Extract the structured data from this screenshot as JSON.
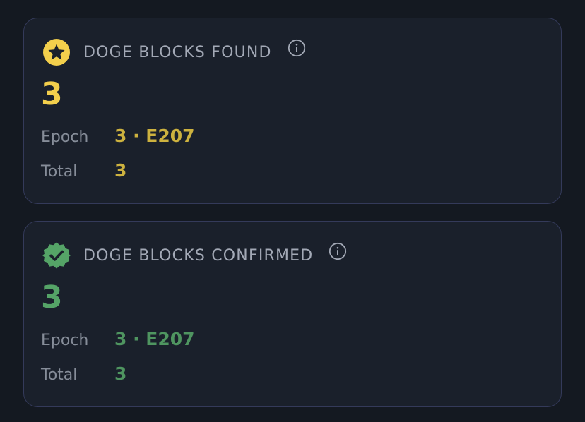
{
  "cards": [
    {
      "id": "found",
      "title": "DOGE BLOCKS FOUND",
      "value": "3",
      "epoch_label": "Epoch",
      "epoch_value": "3 · E207",
      "total_label": "Total",
      "total_value": "3",
      "icon": "star-badge-icon",
      "accent": "#f3cf4c"
    },
    {
      "id": "confirmed",
      "title": "DOGE BLOCKS CONFIRMED",
      "value": "3",
      "epoch_label": "Epoch",
      "epoch_value": "3 · E207",
      "total_label": "Total",
      "total_value": "3",
      "icon": "verified-check-icon",
      "accent": "#55a467"
    }
  ],
  "colors": {
    "background": "#141921",
    "card_background": "#1a202b",
    "card_border": "#343a5a",
    "title": "#a3a9b6",
    "label": "#868d99"
  }
}
